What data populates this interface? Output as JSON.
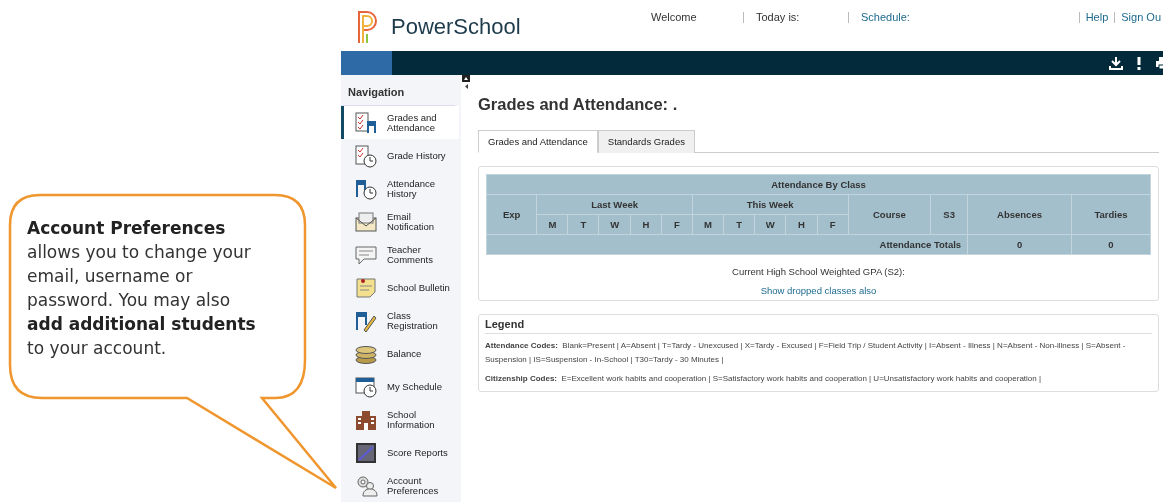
{
  "callout": {
    "text": "**Account Preferences** allows you to change your email, username or password. You may also **add additional students** to your account."
  },
  "header": {
    "logo_text": "PowerSchool",
    "left_links": [
      {
        "text": "Welcome",
        "kind": "label"
      },
      {
        "text": "Today is:",
        "kind": "label"
      },
      {
        "text": "Schedule:",
        "kind": "link"
      }
    ],
    "right_links": [
      {
        "text": "Help",
        "kind": "link"
      },
      {
        "text": "Sign Ou",
        "kind": "link"
      }
    ]
  },
  "sidebar": {
    "title": "Navigation",
    "items": [
      {
        "label": "Grades and Attendance",
        "selected": true
      },
      {
        "label": "Grade History",
        "selected": false
      },
      {
        "label": "Attendance History",
        "selected": false
      },
      {
        "label": "Email Notification",
        "selected": false
      },
      {
        "label": "Teacher Comments",
        "selected": false
      },
      {
        "label": "School Bulletin",
        "selected": false
      },
      {
        "label": "Class Registration",
        "selected": false
      },
      {
        "label": "Balance",
        "selected": false
      },
      {
        "label": "My Schedule",
        "selected": false
      },
      {
        "label": "School Information",
        "selected": false
      },
      {
        "label": "Score Reports",
        "selected": false
      },
      {
        "label": "Account Preferences",
        "selected": false
      }
    ]
  },
  "page_title": "Grades and Attendance: .",
  "tabs": [
    {
      "label": "Grades and Attendance",
      "selected": true
    },
    {
      "label": "Standards Grades",
      "selected": false
    }
  ],
  "attendance_table": {
    "title": "Attendance By Class",
    "exp": "Exp",
    "weeks": [
      {
        "label": "Last Week",
        "days": [
          "M",
          "T",
          "W",
          "H",
          "F"
        ]
      },
      {
        "label": "This Week",
        "days": [
          "M",
          "T",
          "W",
          "H",
          "F"
        ]
      }
    ],
    "course": "Course",
    "term": "S3",
    "absences": "Absences",
    "tardies": "Tardies",
    "totals": {
      "label": "Attendance Totals",
      "absences": "0",
      "tardies": "0"
    }
  },
  "gpa_label": "Current High School Weighted GPA (S2):",
  "dropped_link": "Show dropped classes also",
  "legend": {
    "title": "Legend",
    "rows": [
      {
        "label": "Attendance Codes:",
        "text": "Blank=Present | A=Absent | T=Tardy - Unexcused | X=Tardy - Excused | F=Field Trip / Student Activity | I=Absent - Illness | N=Absent - Non-illness | S=Absent - Suspension | IS=Suspension - In-School | T30=Tardy - 30 Minutes |"
      },
      {
        "label": "Citizenship Codes:",
        "text": "E=Excellent work habits and cooperation | S=Satisfactory work habits and cooperation | U=Unsatisfactory work habits and cooperation |"
      }
    ]
  }
}
